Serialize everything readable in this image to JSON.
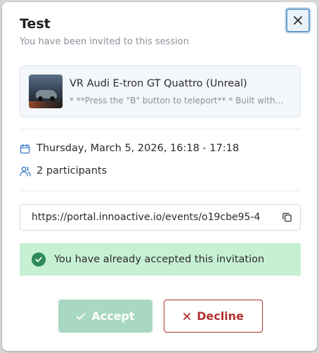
{
  "dialog": {
    "title": "Test",
    "subtitle": "You have been invited to this session",
    "close_icon": "close-icon"
  },
  "experience": {
    "name": "VR Audi E-tron GT Quattro (Unreal)",
    "description": "* **Press the \"B\" button to teleport** * Built with..."
  },
  "session": {
    "datetime": "Thursday, March 5, 2026, 16:18 - 17:18",
    "participants": "2 participants"
  },
  "link": {
    "url": "https://portal.innoactive.io/events/o19cbe95-4",
    "copy_icon": "copy-icon"
  },
  "status": {
    "message": "You have already accepted this invitation",
    "color": "#c6f0d3"
  },
  "actions": {
    "accept_label": "Accept",
    "decline_label": "Decline",
    "accept_color": "#a8d8c2",
    "decline_color": "#b03030"
  }
}
